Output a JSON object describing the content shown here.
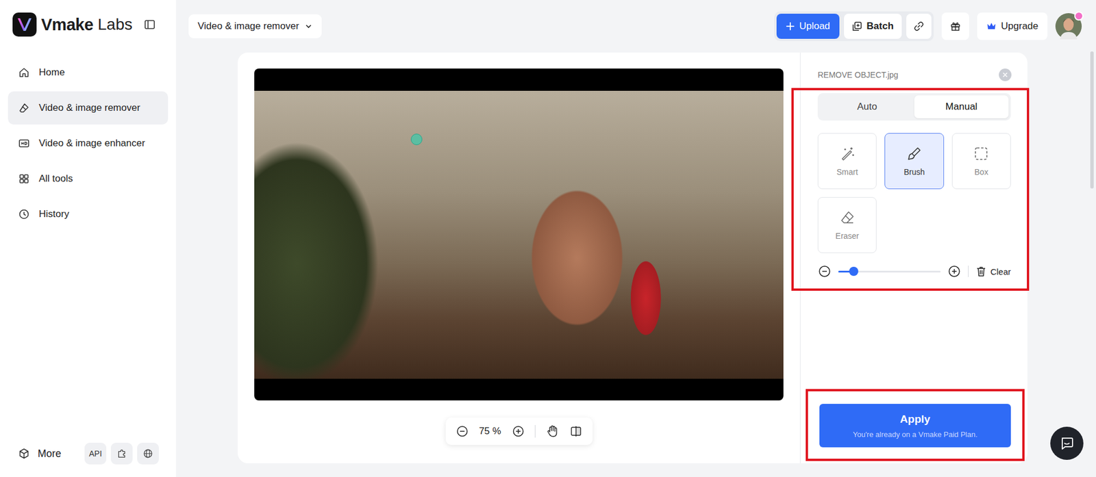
{
  "logo": {
    "brand": "Vmake",
    "sub": "Labs"
  },
  "sidebar": {
    "items": [
      {
        "label": "Home",
        "selected": false
      },
      {
        "label": "Video & image remover",
        "selected": true
      },
      {
        "label": "Video & image enhancer",
        "selected": false
      },
      {
        "label": "All tools",
        "selected": false
      },
      {
        "label": "History",
        "selected": false
      }
    ],
    "footer": {
      "more": "More",
      "api": "API"
    }
  },
  "topbar": {
    "tool_select": "Video & image remover",
    "upload": "Upload",
    "batch": "Batch",
    "upgrade": "Upgrade"
  },
  "editor": {
    "file_name": "REMOVE OBJECT.jpg",
    "zoom": "75 %",
    "mode_tabs": [
      {
        "label": "Auto",
        "selected": false
      },
      {
        "label": "Manual",
        "selected": true
      }
    ],
    "tools": [
      {
        "label": "Smart",
        "selected": false
      },
      {
        "label": "Brush",
        "selected": true
      },
      {
        "label": "Box",
        "selected": false
      },
      {
        "label": "Eraser",
        "selected": false
      }
    ],
    "brush_size": {
      "level": 0.15
    },
    "clear": "Clear",
    "apply": {
      "label": "Apply",
      "note": "You're already on a Vmake Paid Plan."
    }
  }
}
